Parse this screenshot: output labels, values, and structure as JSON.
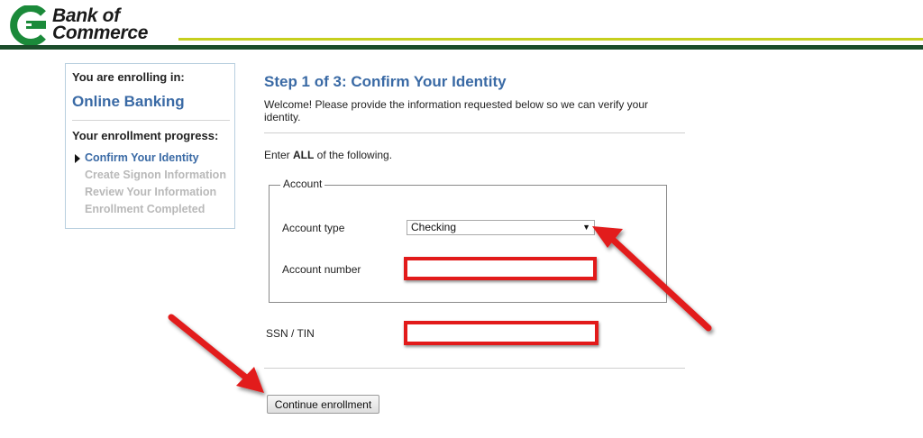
{
  "brand": {
    "name_line1": "Bank of",
    "name_line2": "Commerce",
    "colors": {
      "logo_green": "#1b8a3a",
      "header_yellow": "#c6cf1e",
      "header_dark_green": "#1b4d2b"
    }
  },
  "sidebar": {
    "enrolling_label": "You are enrolling in:",
    "product": "Online Banking",
    "progress_label": "Your enrollment progress:",
    "steps": [
      {
        "label": "Confirm Your Identity",
        "state": "active"
      },
      {
        "label": "Create Signon Information",
        "state": "pending"
      },
      {
        "label": "Review Your Information",
        "state": "pending"
      },
      {
        "label": "Enrollment Completed",
        "state": "pending"
      }
    ]
  },
  "main": {
    "title": "Step 1 of 3: Confirm Your Identity",
    "intro": "Welcome! Please provide the information requested below so we can verify your identity.",
    "enter_all_prefix": "Enter ",
    "enter_all_bold": "ALL",
    "enter_all_suffix": " of the following.",
    "account_fieldset": {
      "legend": "Account",
      "account_type_label": "Account type",
      "account_type_selected": "Checking",
      "account_number_label": "Account number",
      "account_number_value": ""
    },
    "ssn_label": "SSN / TIN",
    "ssn_value": "",
    "continue_label": "Continue enrollment"
  },
  "annotations": {
    "highlight_color": "#e21a1a",
    "arrow_color": "#e21a1a",
    "arrow_targets": [
      "account-type-select",
      "continue-enrollment-button"
    ]
  },
  "icons": {
    "select_caret": "▼",
    "step_marker": "triangle-right-icon"
  }
}
